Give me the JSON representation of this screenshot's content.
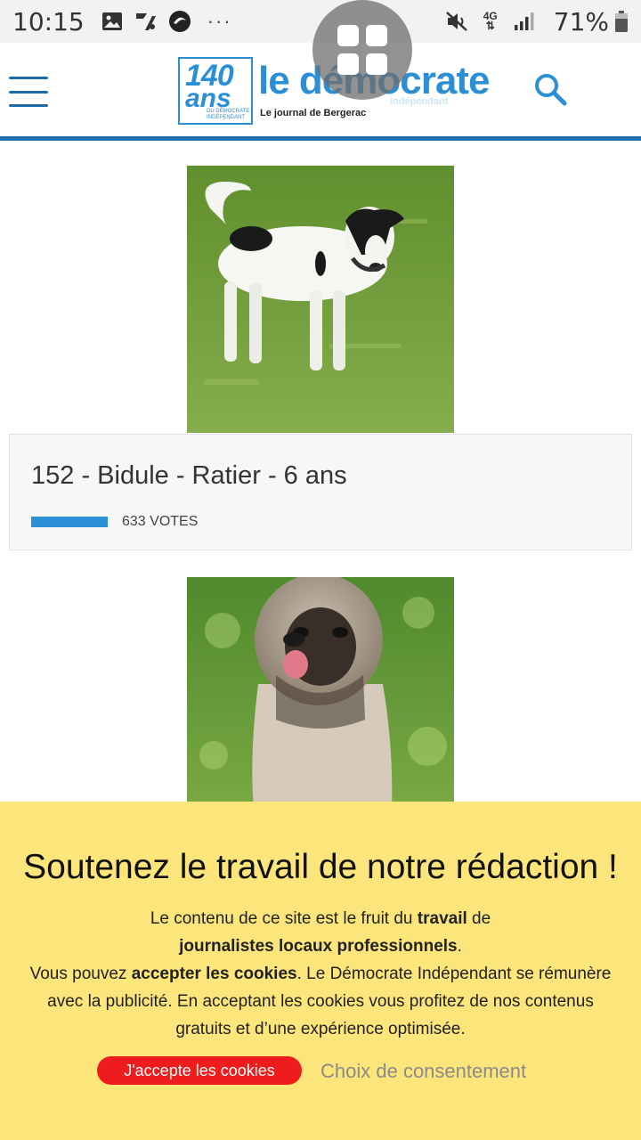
{
  "status_bar": {
    "time": "10:15",
    "dots": "···",
    "network": "4G",
    "battery": "71%",
    "icons": [
      "image-icon",
      "app-icon",
      "app2-icon",
      "mute-icon",
      "network-icon",
      "signal-icon",
      "battery-icon"
    ]
  },
  "header": {
    "logo": {
      "badge_number": "140",
      "badge_ans": "ans",
      "badge_small": "DU DÉMOCRATE INDÉPENDANT",
      "title": "le démocrate",
      "subtitle": "indépendant",
      "tagline": "Le journal de Bergerac"
    },
    "menu_icon": "hamburger-icon",
    "search_icon": "search-icon",
    "accent_color": "#1f6eaf"
  },
  "entries": [
    {
      "label": "152 - Bidule - Ratier - 6 ans",
      "votes_text": "633 VOTES",
      "votes_fraction": 1.0
    }
  ],
  "consent": {
    "title": "Soutenez le travail de notre rédaction !",
    "line1_prefix": "Le contenu de ce site est le fruit du ",
    "line1_bold": "travail",
    "line1_suffix": " de",
    "line2_bold": "journalistes locaux professionnels",
    "line2_suffix": ".",
    "line3_prefix": "Vous pouvez ",
    "line3_bold": "accepter les cookies",
    "line3_suffix": ". Le Démocrate Indépendant se rémunère avec la publicité. En acceptant les cookies vous profitez de nos contenus gratuits et d’une expérience optimisée.",
    "accept_label": "J'accepte les cookies",
    "choice_label": "Choix de consentement",
    "background": "#fce57a",
    "accept_color": "#ee1c1c"
  }
}
